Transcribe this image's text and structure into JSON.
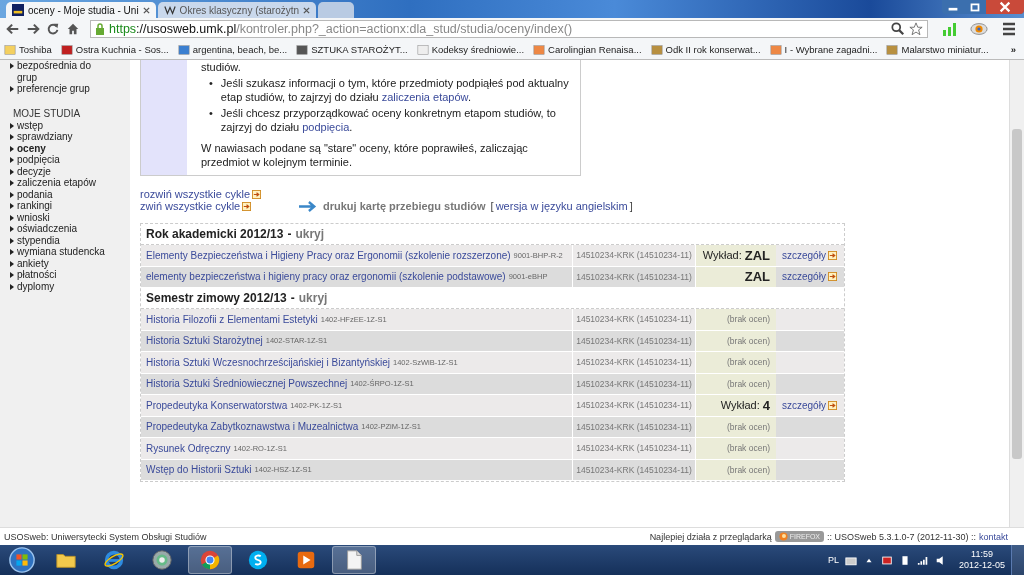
{
  "browser": {
    "tabs": [
      {
        "title": "oceny - Moje studia - Uni",
        "selected": true
      },
      {
        "title": "Okres klasyczny (starożytn",
        "selected": false
      }
    ],
    "address": {
      "scheme": "https",
      "host": "://usosweb.umk.pl",
      "path": "/kontroler.php?_action=actionx:dla_stud/studia/oceny/index()"
    },
    "bookmarks": [
      "Toshiba",
      "Ostra Kuchnia - Sos...",
      "argentina, beach, be...",
      "SZTUKA STAROŻYT...",
      "Kodeksy średniowie...",
      "Carolingian Renaisa...",
      "Odk II rok konserwat...",
      "I - Wybrane zagadni...",
      "Malarstwo miniatur..."
    ],
    "bookmarks_more": "»"
  },
  "sidebar": {
    "top_items": [
      {
        "label": "bezpośrednia do grup",
        "selected": false
      },
      {
        "label": "preferencje grup",
        "selected": false
      }
    ],
    "heading": "MOJE STUDIA",
    "items": [
      {
        "label": "wstęp",
        "selected": false
      },
      {
        "label": "sprawdziany",
        "selected": false
      },
      {
        "label": "oceny",
        "selected": true
      },
      {
        "label": "podpięcia",
        "selected": false
      },
      {
        "label": "decyzje",
        "selected": false
      },
      {
        "label": "zaliczenia etapów",
        "selected": false
      },
      {
        "label": "podania",
        "selected": false
      },
      {
        "label": "rankingi",
        "selected": false
      },
      {
        "label": "wnioski",
        "selected": false
      },
      {
        "label": "oświadczenia",
        "selected": false
      },
      {
        "label": "stypendia",
        "selected": false
      },
      {
        "label": "wymiana studencka",
        "selected": false
      },
      {
        "label": "ankiety",
        "selected": false
      },
      {
        "label": "płatności",
        "selected": false
      },
      {
        "label": "dyplomy",
        "selected": false
      }
    ]
  },
  "info": {
    "lead": "studiów.",
    "marker": "•",
    "bullets": [
      {
        "text": "Jeśli szukasz informacji o tym, które przedmioty podpiąłeś pod aktualny etap studiów, to zajrzyj do działu",
        "link": "zaliczenia etapów",
        "after": "."
      },
      {
        "text": "Jeśli chcesz przyporządkować oceny konkretnym etapom studiów, to zajrzyj do działu",
        "link": "podpięcia",
        "after": "."
      }
    ],
    "note": "W nawiasach podane są \"stare\" oceny, które poprawiłeś, zaliczając przedmiot w kolejnym terminie."
  },
  "actions": {
    "expand": "rozwiń wszystkie cykle",
    "collapse": "zwiń wszystkie cykle",
    "print": "drukuj kartę przebiegu studiów",
    "english_open": "[",
    "english": "wersja w języku angielskim",
    "english_close": "]"
  },
  "groups": [
    {
      "title": "Rok akademicki 2012/13",
      "sep": "-",
      "hide": "ukryj",
      "rows": [
        {
          "name": "Elementy Bezpieczeństwa i Higieny Pracy oraz Ergonomii (szkolenie rozszerzone)",
          "code": "9001-BHP-R-2",
          "program": "14510234-KRK (14510234-11)",
          "grade": {
            "kind": "grade",
            "label": "Wykład:",
            "value": "ZAL"
          },
          "details": "szczegóły"
        },
        {
          "name": "elementy bezpieczeństwa i higieny pracy oraz ergonomii (szkolenie podstawowe)",
          "code": "9001-eBHP",
          "program": "14510234-KRK (14510234-11)",
          "grade": {
            "kind": "grade",
            "value": "ZAL"
          },
          "details": "szczegóły"
        }
      ]
    },
    {
      "title": "Semestr zimowy 2012/13",
      "sep": "-",
      "hide": "ukryj",
      "rows": [
        {
          "name": "Historia Filozofii z Elementami Estetyki",
          "code": "1402-HFzEE-1Z-S1",
          "program": "14510234-KRK (14510234-11)",
          "grade": {
            "kind": "none",
            "value": "(brak ocen)"
          }
        },
        {
          "name": "Historia Sztuki Starożytnej",
          "code": "1402-STAR-1Z-S1",
          "program": "14510234-KRK (14510234-11)",
          "grade": {
            "kind": "none",
            "value": "(brak ocen)"
          }
        },
        {
          "name": "Historia Sztuki Wczesnochrześcijańskiej i Bizantyńskiej",
          "code": "1402-SzWiB-1Z-S1",
          "program": "14510234-KRK (14510234-11)",
          "grade": {
            "kind": "none",
            "value": "(brak ocen)"
          }
        },
        {
          "name": "Historia Sztuki Średniowiecznej Powszechnej",
          "code": "1402-ŚRPO-1Z-S1",
          "program": "14510234-KRK (14510234-11)",
          "grade": {
            "kind": "none",
            "value": "(brak ocen)"
          }
        },
        {
          "name": "Propedeutyka Konserwatorstwa",
          "code": "1402-PK-1Z-S1",
          "program": "14510234-KRK (14510234-11)",
          "grade": {
            "kind": "grade",
            "label": "Wykład:",
            "value": "4"
          },
          "details": "szczegóły"
        },
        {
          "name": "Propedeutyka Zabytkoznawstwa i Muzealnictwa",
          "code": "1402-PZiM-1Z-S1",
          "program": "14510234-KRK (14510234-11)",
          "grade": {
            "kind": "none",
            "value": "(brak ocen)"
          }
        },
        {
          "name": "Rysunek Odręczny",
          "code": "1402-RO-1Z-S1",
          "program": "14510234-KRK (14510234-11)",
          "grade": {
            "kind": "none",
            "value": "(brak ocen)"
          }
        },
        {
          "name": "Wstęp do Historii Sztuki",
          "code": "1402-HSZ-1Z-S1",
          "program": "14510234-KRK (14510234-11)",
          "grade": {
            "kind": "none",
            "value": "(brak ocen)"
          }
        }
      ]
    }
  ],
  "footer": {
    "left": "USOSweb: Uniwersytecki System Obsługi Studiów",
    "best": "Najlepiej działa z przeglądarką",
    "badge": "FIREFOX",
    "version": ":: USOSweb 5.3.1.0-7 (2012-11-30) ::",
    "contact": "kontakt"
  },
  "taskbar": {
    "apps": [
      {
        "kind": "folder",
        "selected": false
      },
      {
        "kind": "ie",
        "selected": false
      },
      {
        "kind": "disc",
        "selected": false
      },
      {
        "kind": "chrome",
        "selected": true
      },
      {
        "kind": "skype",
        "selected": false
      },
      {
        "kind": "player",
        "selected": false
      },
      {
        "kind": "document",
        "selected": true
      }
    ],
    "lang": "PL",
    "time": "11:59",
    "date": "2012-12-05"
  }
}
